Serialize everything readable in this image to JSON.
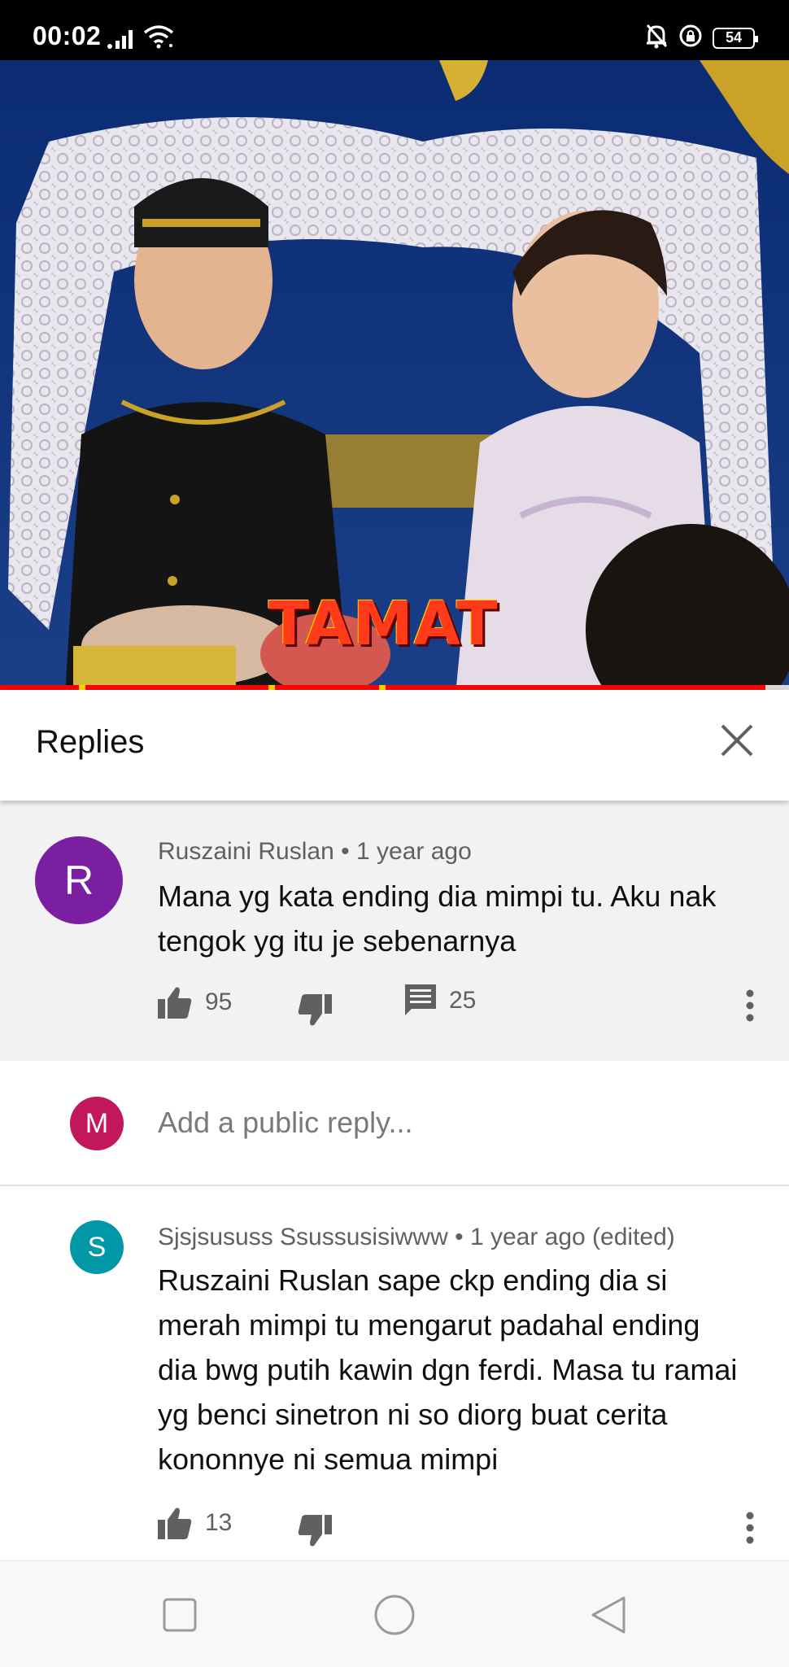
{
  "status_bar": {
    "time": "00:02",
    "battery": "54"
  },
  "video": {
    "overlay_text": "TAMAT",
    "progress": 0.97,
    "chapter_marks": [
      0.1,
      0.34,
      0.48
    ]
  },
  "replies_panel": {
    "title": "Replies"
  },
  "parent_comment": {
    "avatar_letter": "R",
    "avatar_color": "#7b1fa2",
    "author": "Ruszaini Ruslan",
    "separator": "•",
    "time": "1 year ago",
    "text": "Mana yg kata ending dia mimpi tu. Aku nak tengok yg itu je sebenarnya",
    "likes": "95",
    "replies_count": "25"
  },
  "reply_input": {
    "avatar_letter": "M",
    "avatar_color": "#c2185b",
    "placeholder": "Add a public reply..."
  },
  "replies": [
    {
      "avatar_letter": "S",
      "avatar_color": "#0097a7",
      "author": "Sjsjsususs Ssussusisiwww",
      "separator": "•",
      "time": "1 year ago (edited)",
      "text": "Ruszaini Ruslan sape ckp ending dia si merah mimpi tu mengarut padahal ending dia bwg putih kawin dgn ferdi. Masa tu ramai yg benci sinetron ni so diorg buat cerita kononnye ni semua mimpi",
      "likes": "13"
    }
  ]
}
